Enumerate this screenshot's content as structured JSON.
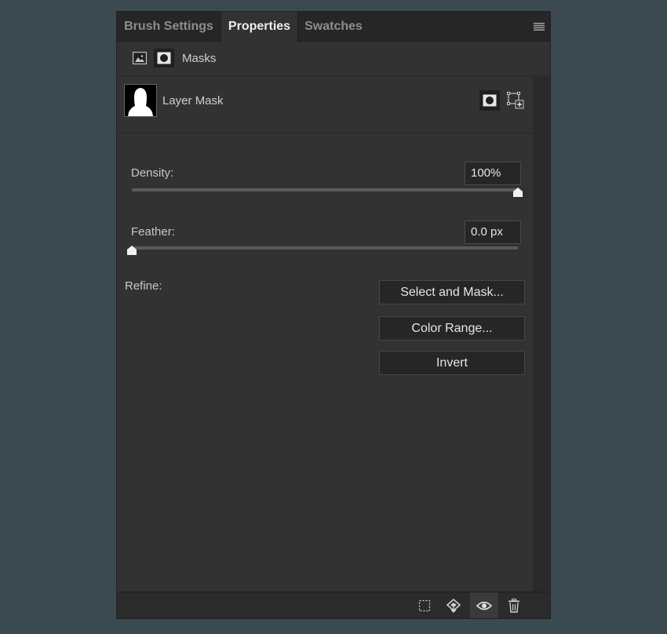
{
  "tabs": [
    {
      "label": "Brush Settings"
    },
    {
      "label": "Properties"
    },
    {
      "label": "Swatches"
    }
  ],
  "header": {
    "masks_label": "Masks"
  },
  "layer_mask": {
    "label": "Layer Mask"
  },
  "density": {
    "label": "Density:",
    "value": "100%",
    "level_percent": 100
  },
  "feather": {
    "label": "Feather:",
    "value": "0.0 px",
    "level_percent": 0
  },
  "refine": {
    "label": "Refine:",
    "buttons": [
      {
        "label": "Select and Mask..."
      },
      {
        "label": "Color Range..."
      },
      {
        "label": "Invert"
      }
    ]
  },
  "icons": {
    "panel_menu": "hamburger-menu-icon",
    "pixel_mask": "image-icon",
    "layer_mask": "layer-mask-icon",
    "add_pixel_mask": "add-pixel-mask-icon",
    "add_vector_mask": "add-vector-mask-icon",
    "load_selection": "selection-icon",
    "apply_mask": "apply-mask-icon",
    "toggle_visibility": "eye-icon",
    "delete": "trash-icon"
  },
  "colors": {
    "background": "#3b4a50",
    "panel": "#323232",
    "tab_active_text": "#ececec",
    "tab_inactive_text": "#8d8d8d"
  }
}
